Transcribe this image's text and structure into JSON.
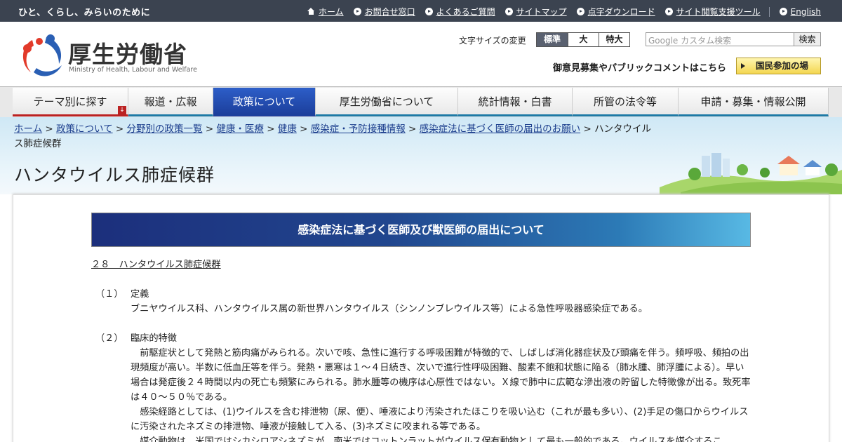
{
  "topbar": {
    "tagline": "ひと、くらし、みらいのために",
    "links": [
      {
        "label": "ホーム",
        "icon": "home-icon"
      },
      {
        "label": "お問合せ窓口",
        "icon": "arrow-circle-icon"
      },
      {
        "label": "よくあるご質問",
        "icon": "arrow-circle-icon"
      },
      {
        "label": "サイトマップ",
        "icon": "arrow-circle-icon"
      },
      {
        "label": "点字ダウンロード",
        "icon": "arrow-circle-icon"
      },
      {
        "label": "サイト閲覧支援ツール",
        "icon": "arrow-circle-icon"
      },
      {
        "label": "English",
        "icon": "arrow-circle-icon"
      }
    ]
  },
  "header": {
    "logo_ja": "厚生労働省",
    "logo_en": "Ministry of Health, Labour and Welfare",
    "font_size_label": "文字サイズの変更",
    "font_sizes": [
      "標準",
      "大",
      "特大"
    ],
    "search_placeholder": "Google カスタム検索",
    "search_button": "検索",
    "public_comment": "御意見募集やパブリックコメントはこちら",
    "kokumin_button": "国民参加の場"
  },
  "nav": {
    "items": [
      "テーマ別に探す",
      "報道・広報",
      "政策について",
      "厚生労働省について",
      "統計情報・白書",
      "所管の法令等",
      "申請・募集・情報公開"
    ],
    "active_index": 2
  },
  "breadcrumb": {
    "items": [
      "ホーム",
      "政策について",
      "分野別の政策一覧",
      "健康・医療",
      "健康",
      "感染症・予防接種情報",
      "感染症法に基づく医師の届出のお願い"
    ],
    "current": "ハンタウイルス肺症候群"
  },
  "page_title": "ハンタウイルス肺症候群",
  "banner": "感染症法に基づく医師及び獣医師の届出について",
  "content": {
    "section_title": "２８　ハンタウイルス肺症候群",
    "s1_num": "（１）",
    "s1_title": "定義",
    "s1_body": "ブニヤウイルス科、ハンタウイルス属の新世界ハンタウイルス（シンノンブレウイルス等）による急性呼吸器感染症である。",
    "s2_num": "（２）",
    "s2_title": "臨床的特徴",
    "s2_p1": "前駆症状として発熱と筋肉痛がみられる。次いで咳、急性に進行する呼吸困難が特徴的で、しばしば消化器症状及び頭痛を伴う。頻呼吸、頻拍の出現頻度が高い。半数に低血圧等を伴う。発熱・悪寒は１～４日続き、次いで進行性呼吸困難、酸素不飽和状態に陥る（肺水腫、肺浮腫による）。早い場合は発症後２４時間以内の死亡も頻繁にみられる。肺水腫等の機序は心原性ではない。Ｘ線で肺中に広範な滲出液の貯留した特徴像が出る。致死率は４０～５０％である。",
    "s2_p2": "感染経路としては、(1)ウイルスを含む排泄物（尿、便）、唾液により汚染されたほこりを吸い込む（これが最も多い）、(2)手足の傷口からウイルスに汚染されたネズミの排泄物、唾液が接触して入る、(3)ネズミに咬まれる等である。",
    "s2_p3": "媒介動物は、米国ではシカシロアシネズミが、南米ではコットンラットがウイルス保有動物として最も一般的である。ウイルスを媒介するこ"
  },
  "colors": {
    "topbar": "#3b4350",
    "nav_active": "#2d5ec8",
    "nav_underline": "#1d7aa6",
    "banner_start": "#1c2f7c",
    "banner_end": "#58b9e4"
  }
}
